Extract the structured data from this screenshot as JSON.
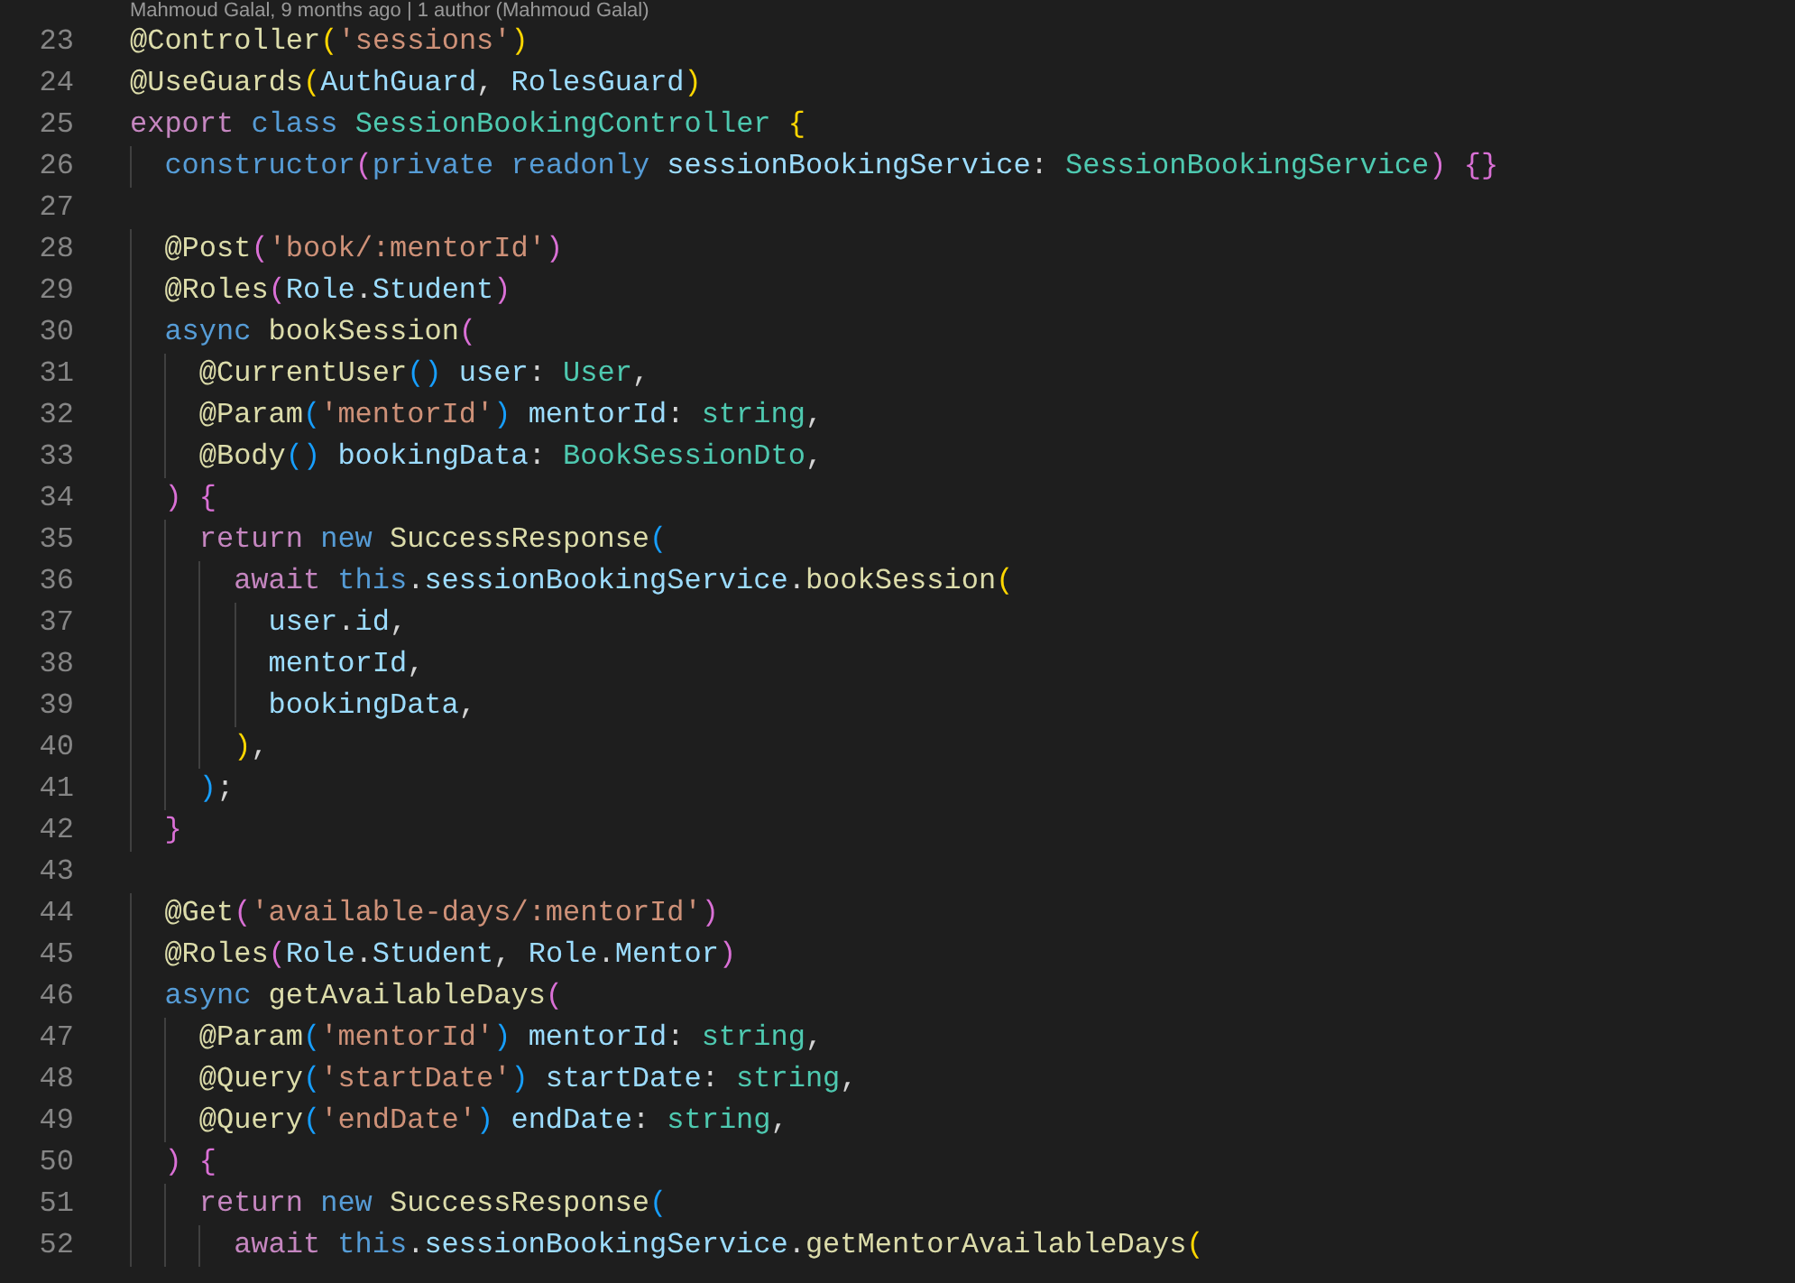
{
  "codelens": "Mahmoud Galal, 9 months ago | 1 author (Mahmoud Galal)",
  "lines": [
    {
      "n": "23",
      "tokens": [
        {
          "text": "@Controller",
          "kind": "dec"
        },
        {
          "text": "(",
          "kind": "b1"
        },
        {
          "text": "'sessions'",
          "kind": "str"
        },
        {
          "text": ")",
          "kind": "b1"
        }
      ]
    },
    {
      "n": "24",
      "tokens": [
        {
          "text": "@UseGuards",
          "kind": "dec"
        },
        {
          "text": "(",
          "kind": "b1"
        },
        {
          "text": "AuthGuard",
          "kind": "var"
        },
        {
          "text": ", ",
          "kind": "punc"
        },
        {
          "text": "RolesGuard",
          "kind": "var"
        },
        {
          "text": ")",
          "kind": "b1"
        }
      ]
    },
    {
      "n": "25",
      "tokens": [
        {
          "text": "export ",
          "kind": "ctl"
        },
        {
          "text": "class ",
          "kind": "kw"
        },
        {
          "text": "SessionBookingController ",
          "kind": "type"
        },
        {
          "text": "{",
          "kind": "b1"
        }
      ]
    },
    {
      "n": "26",
      "tokens": [
        {
          "text": "  constructor",
          "kind": "kw"
        },
        {
          "text": "(",
          "kind": "b2"
        },
        {
          "text": "private readonly ",
          "kind": "kw"
        },
        {
          "text": "sessionBookingService",
          "kind": "var"
        },
        {
          "text": ": ",
          "kind": "punc"
        },
        {
          "text": "SessionBookingService",
          "kind": "type"
        },
        {
          "text": ") {}",
          "kind": "b2"
        }
      ]
    },
    {
      "n": "27"
    },
    {
      "n": "28",
      "tokens": [
        {
          "text": "  @Post",
          "kind": "dec"
        },
        {
          "text": "(",
          "kind": "b2"
        },
        {
          "text": "'book/:mentorId'",
          "kind": "str"
        },
        {
          "text": ")",
          "kind": "b2"
        }
      ]
    },
    {
      "n": "29",
      "tokens": [
        {
          "text": "  @Roles",
          "kind": "dec"
        },
        {
          "text": "(",
          "kind": "b2"
        },
        {
          "text": "Role",
          "kind": "var"
        },
        {
          "text": ".",
          "kind": "punc"
        },
        {
          "text": "Student",
          "kind": "var"
        },
        {
          "text": ")",
          "kind": "b2"
        }
      ]
    },
    {
      "n": "30",
      "tokens": [
        {
          "text": "  async ",
          "kind": "kw"
        },
        {
          "text": "bookSession",
          "kind": "fn"
        },
        {
          "text": "(",
          "kind": "b2"
        }
      ]
    },
    {
      "n": "31",
      "tokens": [
        {
          "text": "    @CurrentUser",
          "kind": "dec"
        },
        {
          "text": "() ",
          "kind": "b3"
        },
        {
          "text": "user",
          "kind": "var"
        },
        {
          "text": ": ",
          "kind": "punc"
        },
        {
          "text": "User",
          "kind": "type"
        },
        {
          "text": ",",
          "kind": "punc"
        }
      ]
    },
    {
      "n": "32",
      "tokens": [
        {
          "text": "    @Param",
          "kind": "dec"
        },
        {
          "text": "(",
          "kind": "b3"
        },
        {
          "text": "'mentorId'",
          "kind": "str"
        },
        {
          "text": ") ",
          "kind": "b3"
        },
        {
          "text": "mentorId",
          "kind": "var"
        },
        {
          "text": ": ",
          "kind": "punc"
        },
        {
          "text": "string",
          "kind": "type"
        },
        {
          "text": ",",
          "kind": "punc"
        }
      ]
    },
    {
      "n": "33",
      "tokens": [
        {
          "text": "    @Body",
          "kind": "dec"
        },
        {
          "text": "() ",
          "kind": "b3"
        },
        {
          "text": "bookingData",
          "kind": "var"
        },
        {
          "text": ": ",
          "kind": "punc"
        },
        {
          "text": "BookSessionDto",
          "kind": "type"
        },
        {
          "text": ",",
          "kind": "punc"
        }
      ]
    },
    {
      "n": "34",
      "tokens": [
        {
          "text": "  ) {",
          "kind": "b2"
        }
      ]
    },
    {
      "n": "35",
      "tokens": [
        {
          "text": "    return ",
          "kind": "ctl"
        },
        {
          "text": "new ",
          "kind": "kw"
        },
        {
          "text": "SuccessResponse",
          "kind": "fn"
        },
        {
          "text": "(",
          "kind": "b3"
        }
      ]
    },
    {
      "n": "36",
      "tokens": [
        {
          "text": "      await ",
          "kind": "ctl"
        },
        {
          "text": "this",
          "kind": "kw"
        },
        {
          "text": ".",
          "kind": "punc"
        },
        {
          "text": "sessionBookingService",
          "kind": "var"
        },
        {
          "text": ".",
          "kind": "punc"
        },
        {
          "text": "bookSession",
          "kind": "fn"
        },
        {
          "text": "(",
          "kind": "b1"
        }
      ]
    },
    {
      "n": "37",
      "tokens": [
        {
          "text": "        user",
          "kind": "var"
        },
        {
          "text": ".",
          "kind": "punc"
        },
        {
          "text": "id",
          "kind": "var"
        },
        {
          "text": ",",
          "kind": "punc"
        }
      ]
    },
    {
      "n": "38",
      "tokens": [
        {
          "text": "        mentorId",
          "kind": "var"
        },
        {
          "text": ",",
          "kind": "punc"
        }
      ]
    },
    {
      "n": "39",
      "tokens": [
        {
          "text": "        bookingData",
          "kind": "var"
        },
        {
          "text": ",",
          "kind": "punc"
        }
      ]
    },
    {
      "n": "40",
      "tokens": [
        {
          "text": "      )",
          "kind": "b1"
        },
        {
          "text": ",",
          "kind": "punc"
        }
      ]
    },
    {
      "n": "41",
      "tokens": [
        {
          "text": "    )",
          "kind": "b3"
        },
        {
          "text": ";",
          "kind": "punc"
        }
      ]
    },
    {
      "n": "42",
      "tokens": [
        {
          "text": "  }",
          "kind": "b2"
        }
      ]
    },
    {
      "n": "43"
    },
    {
      "n": "44",
      "tokens": [
        {
          "text": "  @Get",
          "kind": "dec"
        },
        {
          "text": "(",
          "kind": "b2"
        },
        {
          "text": "'available-days/:mentorId'",
          "kind": "str"
        },
        {
          "text": ")",
          "kind": "b2"
        }
      ]
    },
    {
      "n": "45",
      "tokens": [
        {
          "text": "  @Roles",
          "kind": "dec"
        },
        {
          "text": "(",
          "kind": "b2"
        },
        {
          "text": "Role",
          "kind": "var"
        },
        {
          "text": ".",
          "kind": "punc"
        },
        {
          "text": "Student",
          "kind": "var"
        },
        {
          "text": ", ",
          "kind": "punc"
        },
        {
          "text": "Role",
          "kind": "var"
        },
        {
          "text": ".",
          "kind": "punc"
        },
        {
          "text": "Mentor",
          "kind": "var"
        },
        {
          "text": ")",
          "kind": "b2"
        }
      ]
    },
    {
      "n": "46",
      "tokens": [
        {
          "text": "  async ",
          "kind": "kw"
        },
        {
          "text": "getAvailableDays",
          "kind": "fn"
        },
        {
          "text": "(",
          "kind": "b2"
        }
      ]
    },
    {
      "n": "47",
      "tokens": [
        {
          "text": "    @Param",
          "kind": "dec"
        },
        {
          "text": "(",
          "kind": "b3"
        },
        {
          "text": "'mentorId'",
          "kind": "str"
        },
        {
          "text": ") ",
          "kind": "b3"
        },
        {
          "text": "mentorId",
          "kind": "var"
        },
        {
          "text": ": ",
          "kind": "punc"
        },
        {
          "text": "string",
          "kind": "type"
        },
        {
          "text": ",",
          "kind": "punc"
        }
      ]
    },
    {
      "n": "48",
      "tokens": [
        {
          "text": "    @Query",
          "kind": "dec"
        },
        {
          "text": "(",
          "kind": "b3"
        },
        {
          "text": "'startDate'",
          "kind": "str"
        },
        {
          "text": ") ",
          "kind": "b3"
        },
        {
          "text": "startDate",
          "kind": "var"
        },
        {
          "text": ": ",
          "kind": "punc"
        },
        {
          "text": "string",
          "kind": "type"
        },
        {
          "text": ",",
          "kind": "punc"
        }
      ]
    },
    {
      "n": "49",
      "tokens": [
        {
          "text": "    @Query",
          "kind": "dec"
        },
        {
          "text": "(",
          "kind": "b3"
        },
        {
          "text": "'endDate'",
          "kind": "str"
        },
        {
          "text": ") ",
          "kind": "b3"
        },
        {
          "text": "endDate",
          "kind": "var"
        },
        {
          "text": ": ",
          "kind": "punc"
        },
        {
          "text": "string",
          "kind": "type"
        },
        {
          "text": ",",
          "kind": "punc"
        }
      ]
    },
    {
      "n": "50",
      "tokens": [
        {
          "text": "  ) {",
          "kind": "b2"
        }
      ]
    },
    {
      "n": "51",
      "tokens": [
        {
          "text": "    return ",
          "kind": "ctl"
        },
        {
          "text": "new ",
          "kind": "kw"
        },
        {
          "text": "SuccessResponse",
          "kind": "fn"
        },
        {
          "text": "(",
          "kind": "b3"
        }
      ]
    },
    {
      "n": "52",
      "tokens": [
        {
          "text": "      await ",
          "kind": "ctl"
        },
        {
          "text": "this",
          "kind": "kw"
        },
        {
          "text": ".",
          "kind": "punc"
        },
        {
          "text": "sessionBookingService",
          "kind": "var"
        },
        {
          "text": ".",
          "kind": "punc"
        },
        {
          "text": "getMentorAvailableDays",
          "kind": "fn"
        },
        {
          "text": "(",
          "kind": "b1"
        }
      ]
    }
  ]
}
